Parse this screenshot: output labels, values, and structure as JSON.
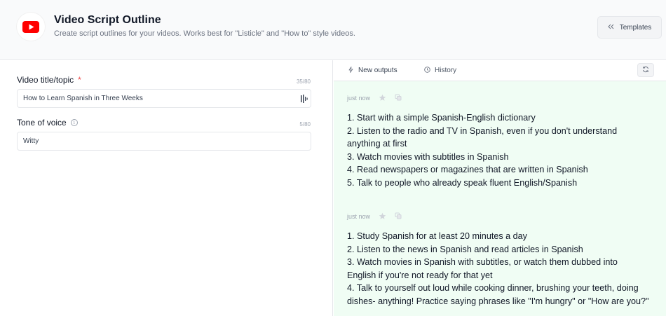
{
  "header": {
    "title": "Video Script Outline",
    "subtitle": "Create script outlines for your videos. Works best for \"Listicle\" and \"How to\" style videos.",
    "templates_label": "Templates",
    "logo_icon": "youtube-logo-icon",
    "brand_color": "#ff0000"
  },
  "form": {
    "title_field": {
      "label": "Video title/topic",
      "required_mark": "*",
      "counter": "35/80",
      "value": "How to Learn Spanish in Three Weeks"
    },
    "tone_field": {
      "label": "Tone of voice",
      "counter": "5/80",
      "value": "Witty"
    }
  },
  "tabs": [
    {
      "label": "New outputs",
      "icon": "sparkle-icon",
      "active": true
    },
    {
      "label": "History",
      "icon": "clock-icon",
      "active": false
    }
  ],
  "outputs": [
    {
      "time": "just now",
      "lines": [
        "1. Start with a simple Spanish-English dictionary",
        "2. Listen to the radio and TV in Spanish, even if you don't understand",
        "anything at first",
        "3. Watch movies with subtitles in Spanish",
        "4. Read newspapers or magazines that are written in Spanish",
        "5. Talk to people who already speak fluent English/Spanish"
      ]
    },
    {
      "time": "just now",
      "lines": [
        "1. Study Spanish for at least 20 minutes a day",
        "2. Listen to the news in Spanish and read articles in Spanish",
        "3. Watch movies in Spanish with subtitles, or watch them dubbed into",
        "English if you're not ready for that yet",
        "4. Talk to yourself out loud while cooking dinner, brushing your teeth, doing",
        "dishes- anything! Practice saying phrases like \"I'm hungry\" or \"How are you?\""
      ]
    }
  ],
  "colors": {
    "output_bg": "#f0fdf4",
    "required": "#ef4444"
  }
}
